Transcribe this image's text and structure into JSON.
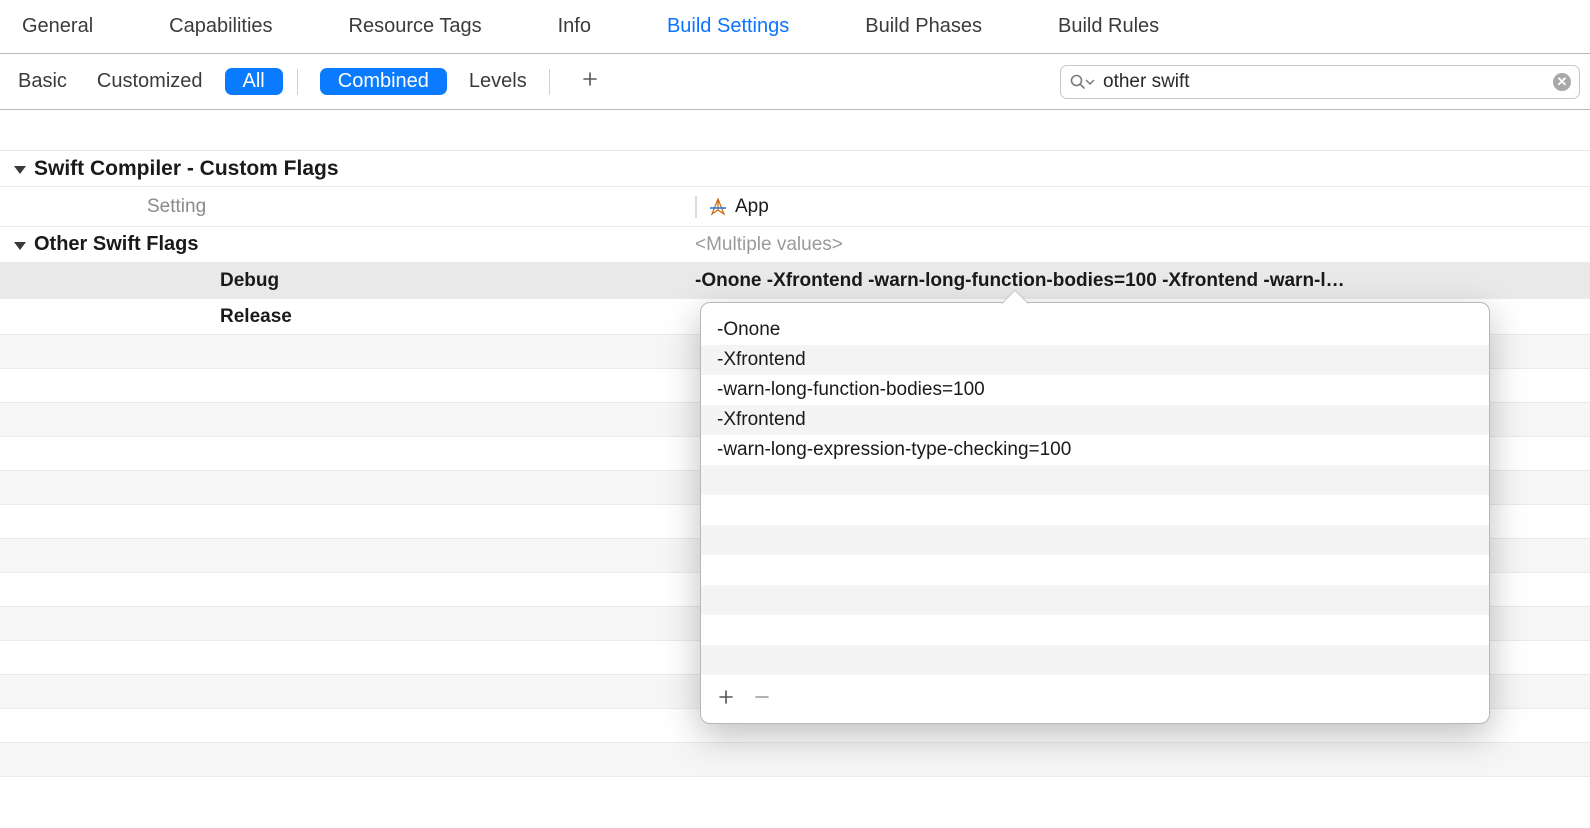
{
  "tabs": {
    "general": "General",
    "capabilities": "Capabilities",
    "resource_tags": "Resource Tags",
    "info": "Info",
    "build_settings": "Build Settings",
    "build_phases": "Build Phases",
    "build_rules": "Build Rules"
  },
  "filter": {
    "basic": "Basic",
    "customized": "Customized",
    "all": "All",
    "combined": "Combined",
    "levels": "Levels"
  },
  "search": {
    "value": "other swift"
  },
  "section": {
    "title": "Swift Compiler - Custom Flags",
    "header_setting": "Setting",
    "header_target": "App",
    "subsection": "Other Swift Flags",
    "multiple_values": "<Multiple values>",
    "rows": [
      {
        "name": "Debug",
        "value": "-Onone -Xfrontend -warn-long-function-bodies=100 -Xfrontend -warn-l…"
      },
      {
        "name": "Release",
        "value": ""
      }
    ]
  },
  "popover": {
    "items": [
      "-Onone",
      "-Xfrontend",
      "-warn-long-function-bodies=100",
      "-Xfrontend",
      "-warn-long-expression-type-checking=100"
    ]
  }
}
